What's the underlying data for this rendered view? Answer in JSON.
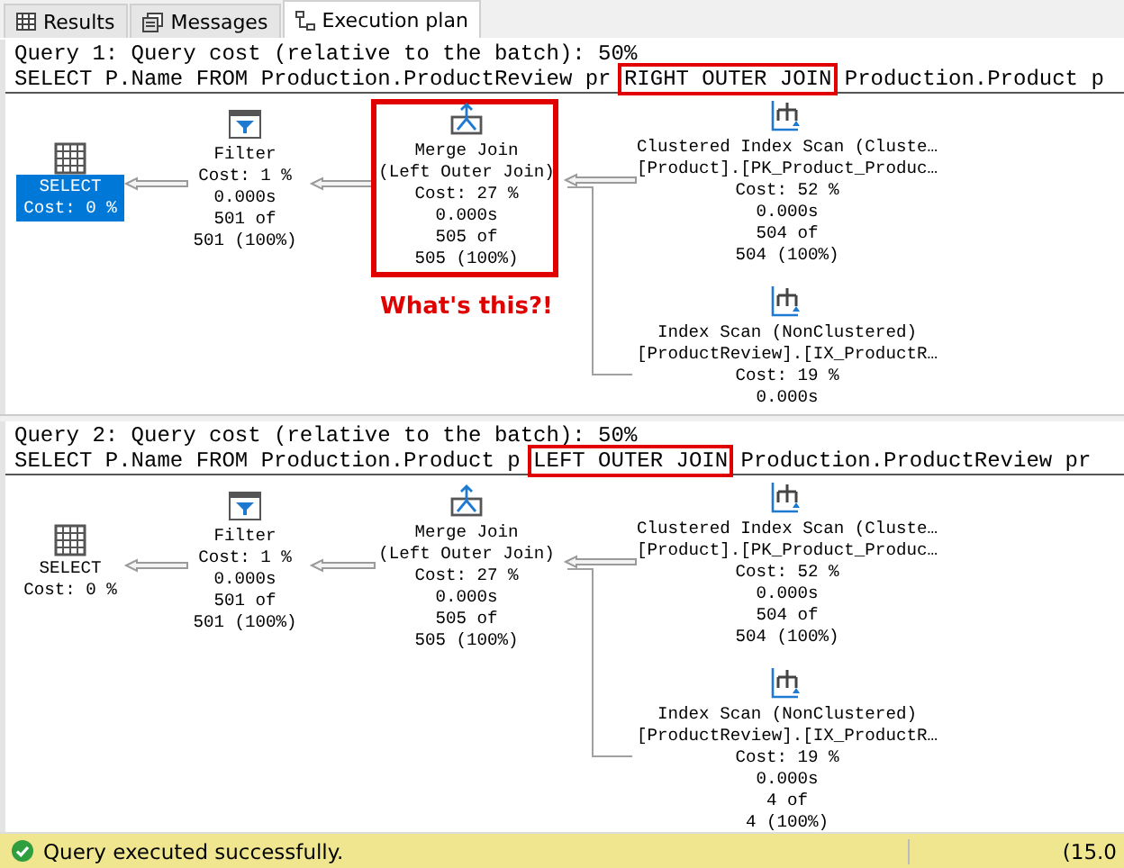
{
  "tabs": [
    {
      "label": "Results",
      "kind": "grid",
      "selected": false
    },
    {
      "label": "Messages",
      "kind": "messages",
      "selected": false
    },
    {
      "label": "Execution plan",
      "kind": "plan",
      "selected": true
    }
  ],
  "queries": [
    {
      "header": "Query 1: Query cost (relative to the batch): 50%",
      "sql": [
        {
          "text": "SELECT P.Name FROM Production.ProductReview pr ",
          "kind": "plain"
        },
        {
          "text": "RIGHT OUTER JOIN",
          "kind": "boxed"
        },
        {
          "text": " Production.Product p",
          "kind": "plain"
        }
      ],
      "annotation": "What's this?!",
      "nodes": [
        {
          "kind": "select",
          "selected": true,
          "lines": [
            "SELECT",
            "Cost: 0 %"
          ]
        },
        {
          "kind": "filter",
          "lines": [
            "Filter",
            "Cost: 1 %",
            "0.000s",
            "501 of",
            "501 (100%)"
          ]
        },
        {
          "kind": "merge_join",
          "highlighted": true,
          "lines": [
            "Merge Join",
            "(Left Outer Join)",
            "Cost: 27 %",
            "0.000s",
            "505 of",
            "505 (100%)"
          ]
        },
        {
          "kind": "clustered_index_scan",
          "lines": [
            "Clustered Index Scan (Cluste…",
            "[Product].[PK_Product_Produc…",
            "Cost: 52 %",
            "0.000s",
            "504 of",
            "504 (100%)"
          ]
        },
        {
          "kind": "index_scan",
          "lines": [
            "Index Scan (NonClustered)",
            "[ProductReview].[IX_ProductR…",
            "Cost: 19 %",
            "0.000s"
          ]
        }
      ]
    },
    {
      "header": "Query 2: Query cost (relative to the batch): 50%",
      "sql": [
        {
          "text": "SELECT P.Name FROM Production.Product p ",
          "kind": "plain"
        },
        {
          "text": "LEFT OUTER JOIN",
          "kind": "boxed"
        },
        {
          "text": " Production.ProductReview pr",
          "kind": "plain"
        }
      ],
      "nodes": [
        {
          "kind": "select",
          "selected": false,
          "lines": [
            "SELECT",
            "Cost: 0 %"
          ]
        },
        {
          "kind": "filter",
          "lines": [
            "Filter",
            "Cost: 1 %",
            "0.000s",
            "501 of",
            "501 (100%)"
          ]
        },
        {
          "kind": "merge_join",
          "lines": [
            "Merge Join",
            "(Left Outer Join)",
            "Cost: 27 %",
            "0.000s",
            "505 of",
            "505 (100%)"
          ]
        },
        {
          "kind": "clustered_index_scan",
          "lines": [
            "Clustered Index Scan (Cluste…",
            "[Product].[PK_Product_Produc…",
            "Cost: 52 %",
            "0.000s",
            "504 of",
            "504 (100%)"
          ]
        },
        {
          "kind": "index_scan",
          "lines": [
            "Index Scan (NonClustered)",
            "[ProductReview].[IX_ProductR…",
            "Cost: 19 %",
            "0.000s",
            "4 of",
            "4 (100%)"
          ]
        }
      ]
    }
  ],
  "status_bar": {
    "message": "Query executed successfully.",
    "server": "(15.0"
  }
}
